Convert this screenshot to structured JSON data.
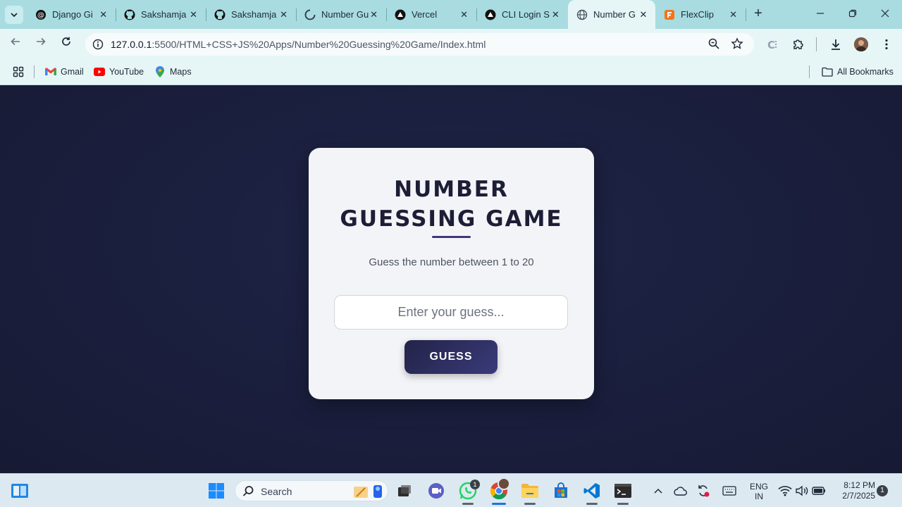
{
  "browser": {
    "tabs": [
      {
        "title": "Django Gi",
        "icon": "threads-icon"
      },
      {
        "title": "Sakshamja",
        "icon": "github-icon"
      },
      {
        "title": "Sakshamja",
        "icon": "github-icon"
      },
      {
        "title": "Number Gu",
        "icon": "loading-icon"
      },
      {
        "title": "Vercel",
        "icon": "vercel-icon"
      },
      {
        "title": "CLI Login S",
        "icon": "vercel-icon"
      },
      {
        "title": "Number G",
        "icon": "globe-icon",
        "active": true
      },
      {
        "title": "FlexClip",
        "icon": "flexclip-icon"
      }
    ],
    "url_host": "127.0.0.1",
    "url_path": ":5500/HTML+CSS+JS%20Apps/Number%20Guessing%20Game/Index.html",
    "bookmarks": [
      {
        "label": "Gmail",
        "icon": "gmail-icon"
      },
      {
        "label": "YouTube",
        "icon": "youtube-icon"
      },
      {
        "label": "Maps",
        "icon": "maps-icon"
      }
    ],
    "all_bookmarks_label": "All Bookmarks"
  },
  "game": {
    "title": "NUMBER GUESSING GAME",
    "subtitle": "Guess the number between 1 to 20",
    "input_placeholder": "Enter your guess...",
    "button_label": "GUESS"
  },
  "taskbar": {
    "search_label": "Search",
    "language_line1": "ENG",
    "language_line2": "IN",
    "time": "8:12 PM",
    "date": "2/7/2025",
    "notification_count": "1",
    "whatsapp_badge": "1"
  },
  "colors": {
    "page_bg": "#1a1d3a",
    "card_bg": "#f3f4f7",
    "accent": "#3b3a7a",
    "title_text": "#1c1e36"
  }
}
